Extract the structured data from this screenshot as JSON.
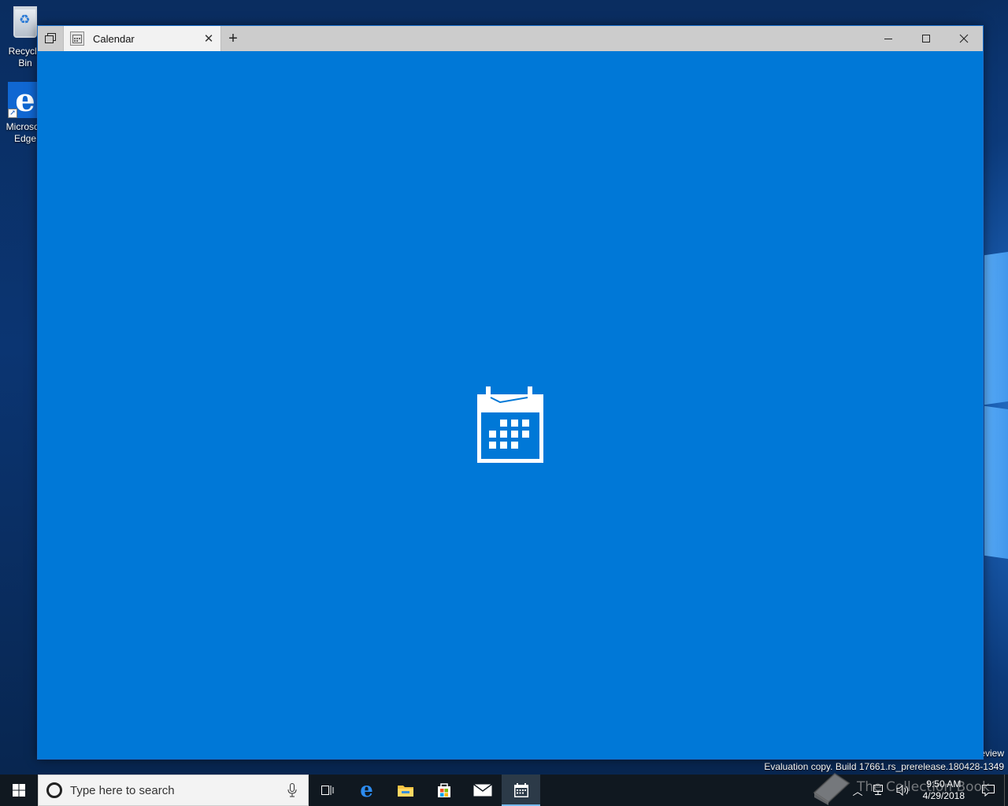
{
  "desktop": {
    "icons": [
      {
        "label": "Recycle Bin"
      },
      {
        "label": "Microsoft Edge"
      }
    ],
    "eval_prev": "eview",
    "eval_text": "Evaluation copy. Build 17661.rs_prerelease.180428-1349"
  },
  "window": {
    "tab": {
      "title": "Calendar"
    },
    "splash_icon": "calendar-icon",
    "background": "#0078d7"
  },
  "taskbar": {
    "search_placeholder": "Type here to search",
    "apps": [
      "task-view-icon",
      "edge-icon",
      "file-explorer-icon",
      "store-icon",
      "mail-icon",
      "calendar-icon"
    ],
    "clock": {
      "time": "9:50 AM",
      "date": "4/29/2018"
    }
  },
  "watermark": {
    "text": "The Collection Book"
  }
}
